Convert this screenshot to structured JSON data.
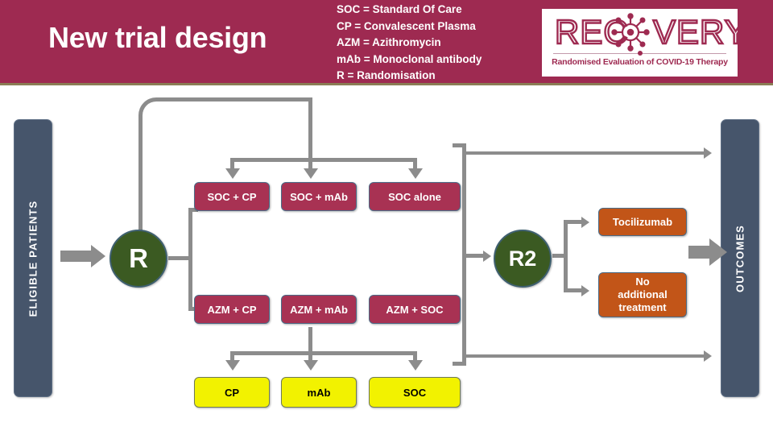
{
  "header": {
    "title": "New trial design",
    "legend": [
      "SOC = Standard Of Care",
      "CP = Convalescent Plasma",
      "AZM = Azithromycin",
      "mAb = Monoclonal antibody",
      "R = Randomisation"
    ],
    "logo": {
      "word_left": "REC",
      "word_right": "VERY",
      "subtitle": "Randomised Evaluation of COVID-19 Therapy"
    }
  },
  "sidebars": {
    "left_label": "ELIGIBLE PATIENTS",
    "right_label": "OUTCOMES"
  },
  "nodes": {
    "randomisation_1": "R",
    "randomisation_2": "R2"
  },
  "arms": {
    "soc_row": [
      {
        "label": "SOC + CP"
      },
      {
        "label": "SOC + mAb"
      },
      {
        "label": "SOC alone"
      }
    ],
    "azm_row": [
      {
        "label": "AZM + CP"
      },
      {
        "label": "AZM + mAb"
      },
      {
        "label": "AZM + SOC"
      }
    ],
    "plain_row": [
      {
        "label": "CP"
      },
      {
        "label": "mAb"
      },
      {
        "label": "SOC"
      }
    ],
    "second_randomisation": [
      {
        "label": "Tocilizumab"
      },
      {
        "label_line1": "No",
        "label_line2": "additional",
        "label_line3": "treatment"
      }
    ]
  },
  "colors": {
    "header_maroon": "#9e2a51",
    "box_maroon": "#a83253",
    "box_yellow": "#f2f200",
    "box_orange": "#c25518",
    "circle_green": "#3b5a22",
    "sidebar_blue": "#46556b",
    "connector_grey": "#8c8c8c"
  }
}
